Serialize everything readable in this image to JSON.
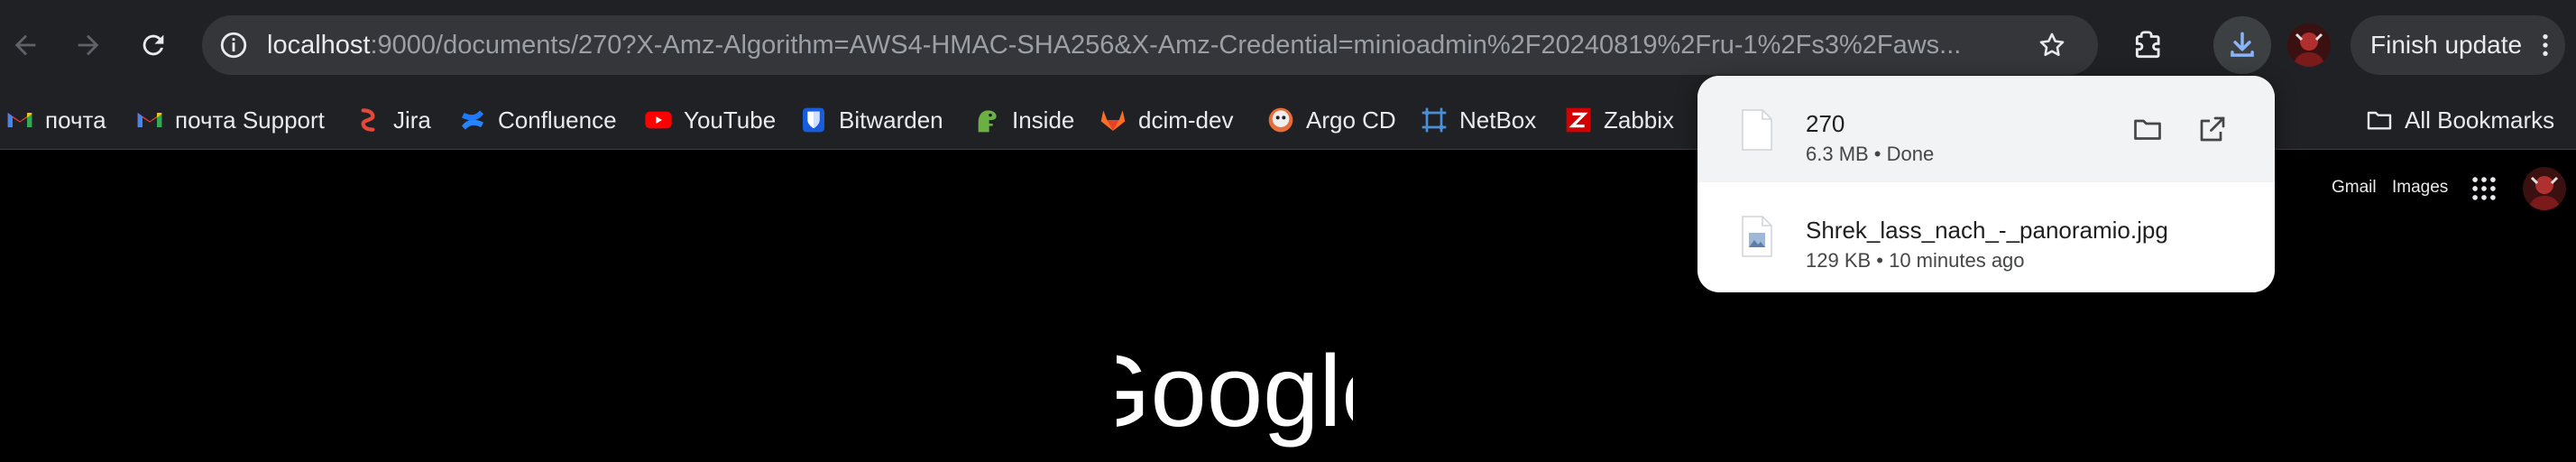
{
  "toolbar": {
    "url_host": "localhost",
    "url_rest": ":9000/documents/270?X-Amz-Algorithm=AWS4-HMAC-SHA256&X-Amz-Credential=minioadmin%2F20240819%2Fru-1%2Fs3%2Faws...",
    "finish_update_label": "Finish update",
    "icons": [
      "back-icon",
      "forward-icon",
      "reload-icon",
      "site-info-icon",
      "star-icon",
      "extensions-icon",
      "download-icon",
      "profile-avatar",
      "more-vert-icon"
    ]
  },
  "bookmarks": [
    {
      "label": "почта",
      "icon": "gmail-icon"
    },
    {
      "label": "почта Support",
      "icon": "gmail-icon"
    },
    {
      "label": "Jira",
      "icon": "jira-icon"
    },
    {
      "label": "Confluence",
      "icon": "confluence-icon"
    },
    {
      "label": "YouTube",
      "icon": "youtube-icon"
    },
    {
      "label": "Bitwarden",
      "icon": "bitwarden-icon"
    },
    {
      "label": "Inside",
      "icon": "dinosaur-icon"
    },
    {
      "label": "dcim-dev",
      "icon": "gitlab-icon"
    },
    {
      "label": "Argo CD",
      "icon": "argo-icon"
    },
    {
      "label": "NetBox",
      "icon": "netbox-icon"
    },
    {
      "label": "Zabbix",
      "icon": "zabbix-icon"
    }
  ],
  "all_bookmarks_label": "All Bookmarks",
  "downloads": [
    {
      "name": "270",
      "meta": "6.3 MB • Done"
    },
    {
      "name": "Shrek_lass_nach_-_panoramio.jpg",
      "meta": "129 KB • 10 minutes ago"
    }
  ],
  "google_header": {
    "gmail_label": "Gmail",
    "images_label": "Images"
  },
  "colors": {
    "toolbar_bg": "#202124",
    "omnibox_bg": "#35363a",
    "accent_blue": "#8ab4f8",
    "page_bg": "#000000"
  }
}
